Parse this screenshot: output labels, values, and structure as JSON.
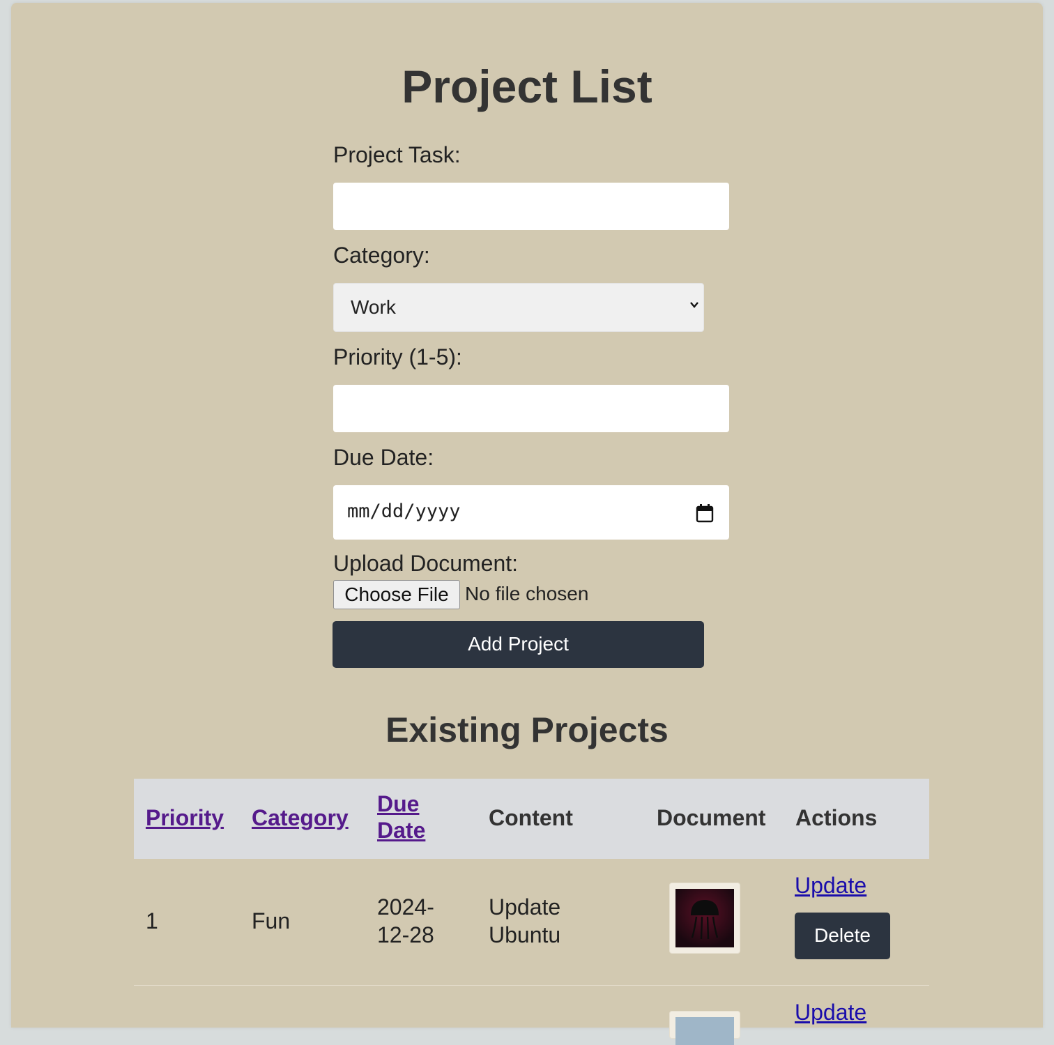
{
  "page": {
    "title": "Project List"
  },
  "form": {
    "task_label": "Project Task:",
    "task_value": "",
    "category_label": "Category:",
    "category_selected": "Work",
    "priority_label": "Priority (1-5):",
    "priority_value": "",
    "due_label": "Due Date:",
    "due_placeholder": "mm/dd/yyyy",
    "upload_label": "Upload Document:",
    "choose_file_label": "Choose File",
    "file_status": "No file chosen",
    "submit_label": "Add Project"
  },
  "projects": {
    "heading": "Existing Projects",
    "columns": {
      "priority": "Priority",
      "category": "Category",
      "due_date_line1": "Due",
      "due_date_line2": "Date",
      "content": "Content",
      "document": "Document",
      "actions": "Actions"
    },
    "rows": [
      {
        "priority": "1",
        "category": "Fun",
        "due_line1": "2024-",
        "due_line2": "12-28",
        "content_line1": "Update",
        "content_line2": "Ubuntu",
        "update_label": "Update",
        "delete_label": "Delete"
      },
      {
        "update_label": "Update"
      }
    ]
  },
  "colors": {
    "background": "#d2c9b1",
    "button": "#2c3440",
    "table_header": "#dadcdf",
    "link": "#1a0dab",
    "visited_link": "#551a8b"
  }
}
